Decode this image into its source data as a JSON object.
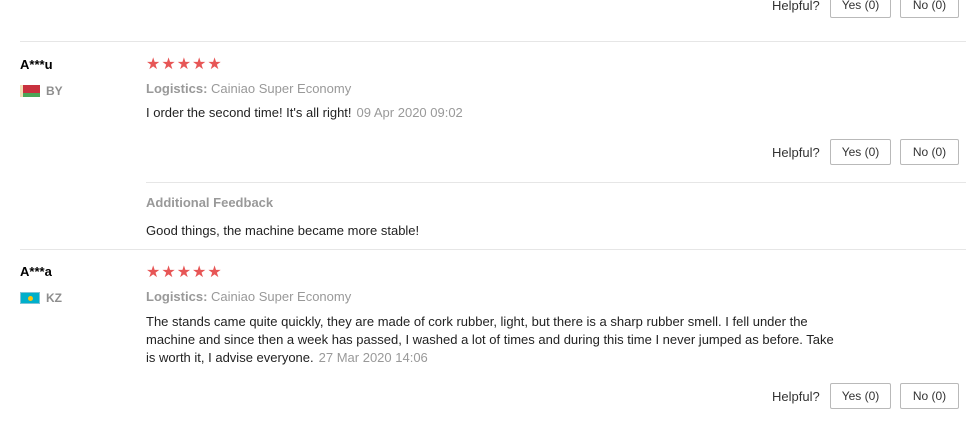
{
  "helpful": {
    "label": "Helpful?",
    "yes": "Yes (0)",
    "no": "No (0)"
  },
  "reviews": [
    {
      "name": "A***u",
      "country": "BY",
      "stars": "★★★★★",
      "logistics_label": "Logistics:",
      "logistics_value": "Cainiao Super Economy",
      "text": "I order the second time! It's all right!",
      "date": "09 Apr 2020 09:02",
      "additional_title": "Additional Feedback",
      "additional_text": "Good things, the machine became more stable!"
    },
    {
      "name": "A***a",
      "country": "KZ",
      "stars": "★★★★★",
      "logistics_label": "Logistics:",
      "logistics_value": "Cainiao Super Economy",
      "text_lines": [
        "The stands came quite quickly, they are made of cork rubber, light, but there is a sharp rubber smell. I fell under the",
        "machine and since then a week has passed, I washed a lot of times and during this time I never jumped as before. Take",
        "is worth it, I advise everyone."
      ],
      "date": "27 Mar 2020 14:06"
    }
  ],
  "colors": {
    "star": "#e75656",
    "muted": "#999999",
    "border": "#b9b9b9"
  }
}
